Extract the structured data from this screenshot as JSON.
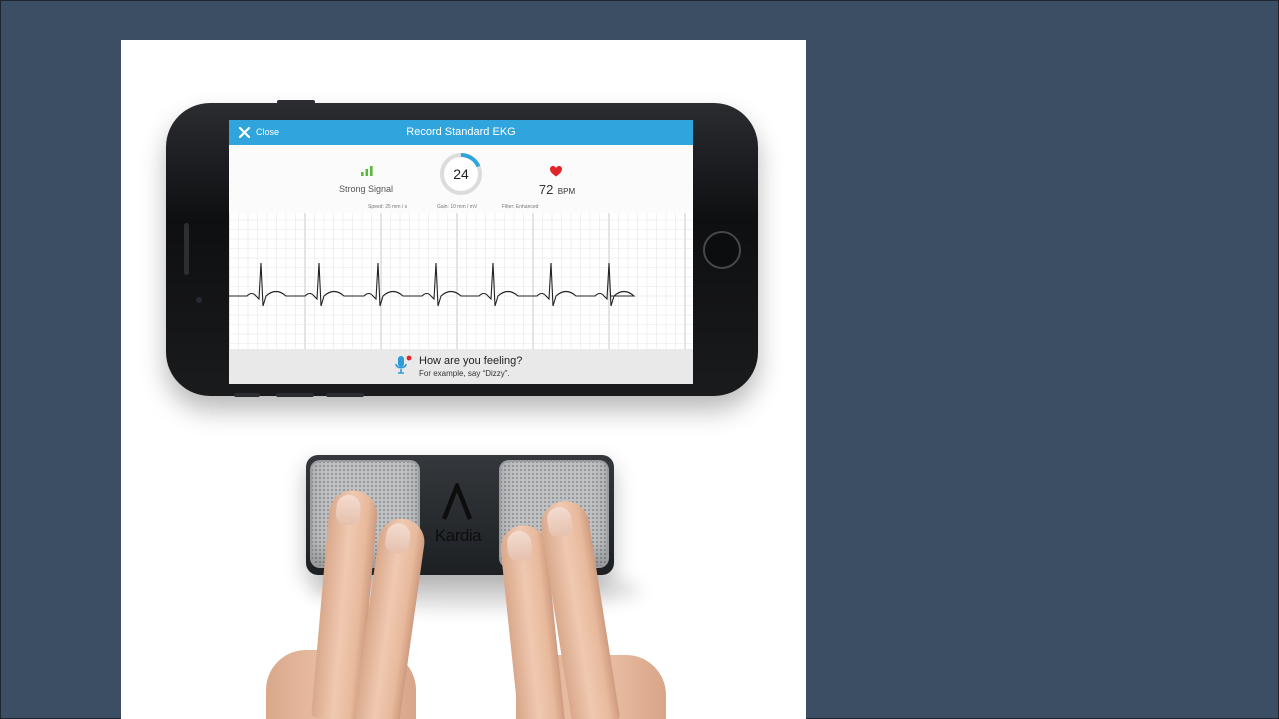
{
  "app": {
    "close_label": "Close",
    "title": "Record Standard EKG"
  },
  "status": {
    "signal_label": "Strong Signal",
    "countdown": "24",
    "heart_rate": "72",
    "heart_rate_unit": "BPM"
  },
  "recording": {
    "speed": "Speed: 25 mm / s",
    "gain": "Gain: 10 mm / mV",
    "filter": "Filter: Enhanced"
  },
  "prompt": {
    "question": "How are you feeling?",
    "hint": "For example, say “Dizzy”."
  },
  "device": {
    "brand": "Kardia"
  },
  "colors": {
    "page_background": "#3b4e63",
    "app_bar": "#30a4dc",
    "signal_green": "#5cb83c",
    "heart_red": "#e0262b",
    "ekg_grid": "#d9d9d9",
    "ekg_trace": "#222222",
    "mic_blue": "#2f9bd6"
  },
  "icons": {
    "close": "close-icon",
    "signal": "signal-bars-icon",
    "timer": "countdown-ring-icon",
    "heart": "heart-icon",
    "mic": "microphone-icon"
  }
}
